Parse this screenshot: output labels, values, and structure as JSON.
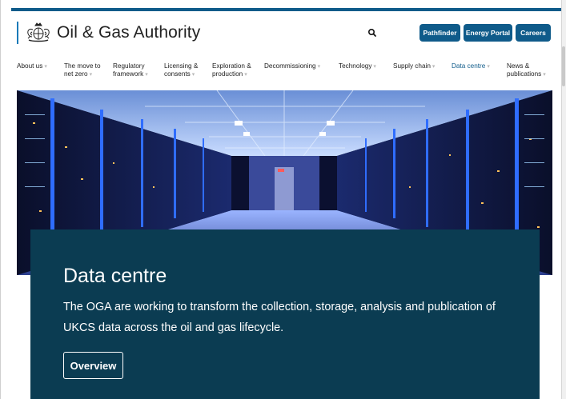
{
  "brand": {
    "name": "Oil & Gas Authority"
  },
  "header": {
    "search_icon": "search-icon",
    "buttons": [
      {
        "label": "Pathfinder"
      },
      {
        "label": "Energy Portal"
      },
      {
        "label": "Careers"
      }
    ]
  },
  "nav": {
    "items": [
      {
        "line1": "About us",
        "line2": ""
      },
      {
        "line1": "The move to",
        "line2": "net zero"
      },
      {
        "line1": "Regulatory",
        "line2": "framework"
      },
      {
        "line1": "Licensing &",
        "line2": "consents"
      },
      {
        "line1": "Exploration &",
        "line2": "production"
      },
      {
        "line1": "Decommissioning",
        "line2": ""
      },
      {
        "line1": "Technology",
        "line2": ""
      },
      {
        "line1": "Supply chain",
        "line2": ""
      },
      {
        "line1": "Data centre",
        "line2": ""
      },
      {
        "line1": "News &",
        "line2": "publications"
      }
    ],
    "active_index": 8
  },
  "hero": {
    "image": "data-centre-server-aisle",
    "title": "Data centre",
    "description": "The OGA are working to transform the collection, storage, analysis and publication of UKCS data across the oil and gas lifecycle.",
    "button_label": "Overview"
  },
  "colors": {
    "brand_blue": "#0f5b8a",
    "panel": "#0b3c52",
    "accent_bar": "#1a7ab8"
  }
}
